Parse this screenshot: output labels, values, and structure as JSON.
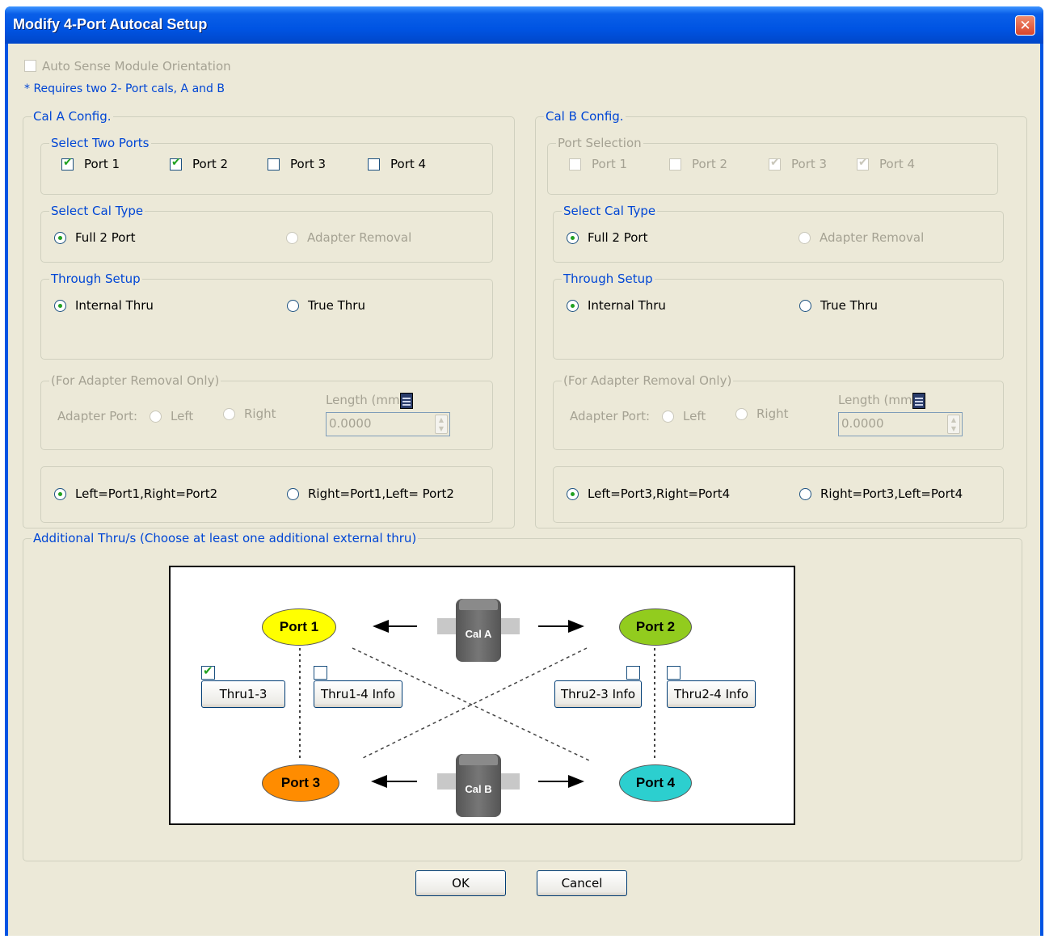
{
  "window": {
    "title": "Modify 4-Port Autocal Setup",
    "close_glyph": "✕"
  },
  "top": {
    "auto_sense_label": "Auto Sense Module Orientation",
    "auto_sense_checked": false,
    "requires_note": "* Requires two 2- Port cals, A and B"
  },
  "calA": {
    "title": "Cal A Config.",
    "ports_title": "Select Two Ports",
    "ports": [
      {
        "label": "Port 1",
        "checked": true
      },
      {
        "label": "Port 2",
        "checked": true
      },
      {
        "label": "Port 3",
        "checked": false
      },
      {
        "label": "Port 4",
        "checked": false
      }
    ],
    "caltype_title": "Select Cal Type",
    "full2port": "Full 2 Port",
    "adapter_removal": "Adapter Removal",
    "through_title": "Through Setup",
    "internal_thru": "Internal Thru",
    "true_thru": "True Thru",
    "adapter_title": "(For Adapter Removal Only)",
    "adapter_port": "Adapter Port:",
    "left": "Left",
    "right": "Right",
    "length_label": "Length (mm)",
    "length_value": "0.0000",
    "orient1": "Left=Port1,Right=Port2",
    "orient2": "Right=Port1,Left= Port2"
  },
  "calB": {
    "title": "Cal B Config.",
    "ports_title": "Port Selection",
    "ports": [
      {
        "label": "Port 1",
        "checked": false
      },
      {
        "label": "Port 2",
        "checked": false
      },
      {
        "label": "Port 3",
        "checked": true
      },
      {
        "label": "Port 4",
        "checked": true
      }
    ],
    "caltype_title": "Select Cal Type",
    "full2port": "Full 2 Port",
    "adapter_removal": "Adapter Removal",
    "through_title": "Through Setup",
    "internal_thru": "Internal Thru",
    "true_thru": "True Thru",
    "adapter_title": "(For Adapter Removal Only)",
    "adapter_port": "Adapter Port:",
    "left": "Left",
    "right": "Right",
    "length_label": "Length (mm)",
    "length_value": "0.0000",
    "orient1": "Left=Port3,Right=Port4",
    "orient2": "Right=Port3,Left=Port4"
  },
  "additional": {
    "title": "Additional Thru/s (Choose at least one additional external thru)"
  },
  "diagram": {
    "port1": "Port 1",
    "port2": "Port 2",
    "port3": "Port 3",
    "port4": "Port 4",
    "cal_a": "Cal A",
    "cal_b": "Cal B",
    "thru13": "Thru1-3",
    "thru14": "Thru1-4 Info",
    "thru23": "Thru2-3 Info",
    "thru24": "Thru2-4 Info",
    "thru13_checked": true,
    "thru14_checked": false,
    "thru23_checked": false,
    "thru24_checked": false,
    "colors": {
      "port1": "#ffff00",
      "port2": "#92cc1e",
      "port3": "#ff8c00",
      "port4": "#2ccfcf"
    }
  },
  "buttons": {
    "ok": "OK",
    "cancel": "Cancel"
  },
  "colors": {
    "accent": "#0046d5",
    "check": "#21a121",
    "dialog_bg": "#ece9d8",
    "title_bar": "#0054e3"
  }
}
